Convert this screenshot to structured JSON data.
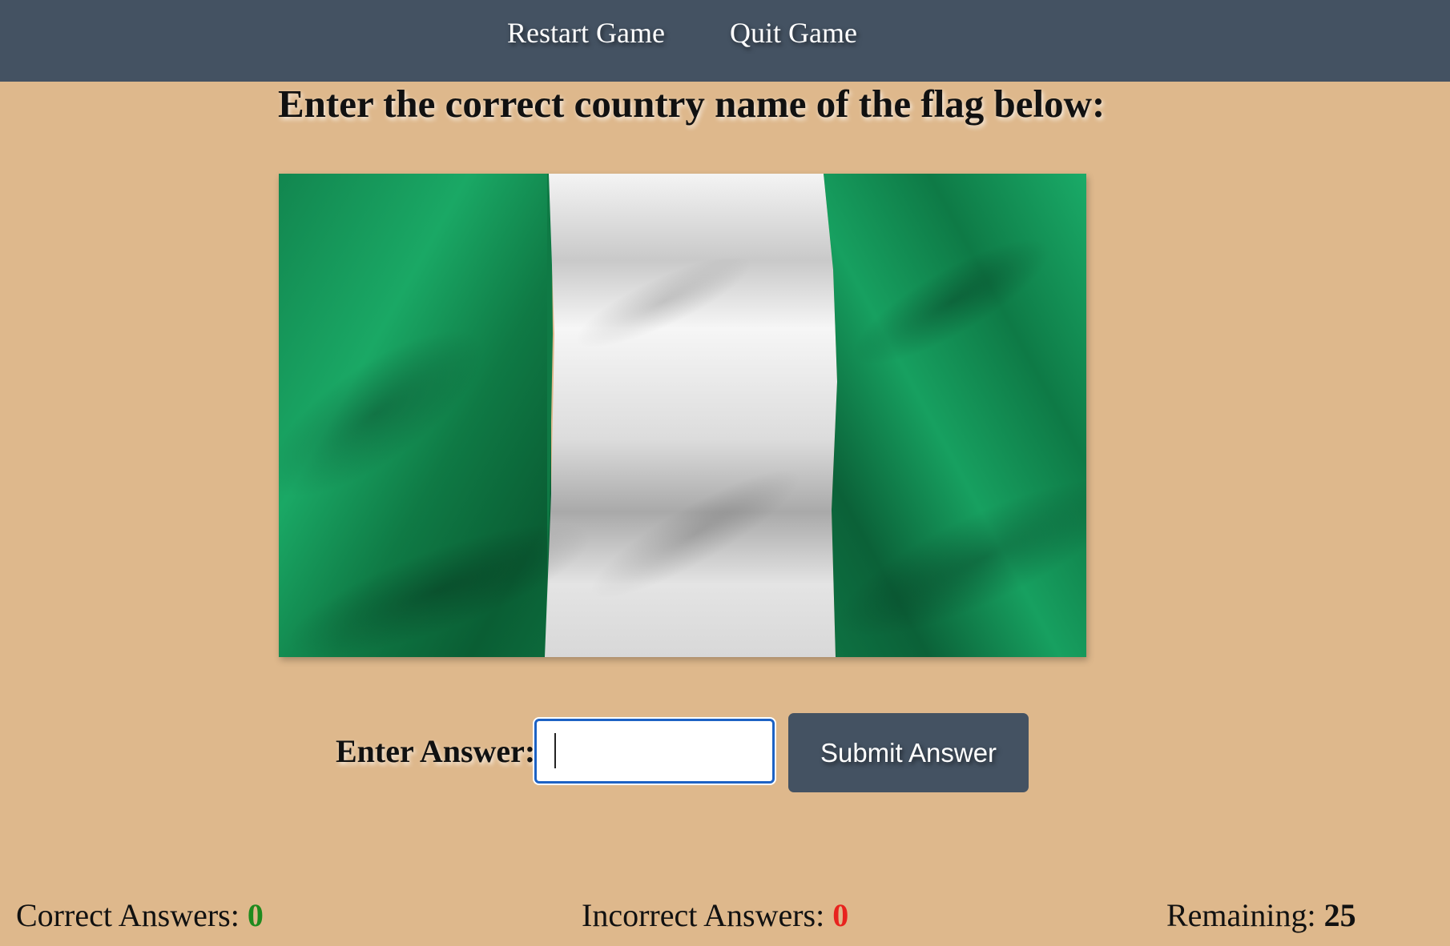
{
  "nav": {
    "restart_label": "Restart Game",
    "quit_label": "Quit Game"
  },
  "prompt": "Enter the correct country name of the flag below:",
  "flag": {
    "icon": "flag-image",
    "colors": {
      "green": "#13915a",
      "white": "#f2f2f2"
    }
  },
  "answer": {
    "label": "Enter Answer:",
    "value": "",
    "submit_label": "Submit Answer"
  },
  "stats": {
    "correct_label": "Correct Answers:",
    "correct_value": "0",
    "correct_color": "#1e8a1e",
    "incorrect_label": "Incorrect Answers:",
    "incorrect_value": "0",
    "incorrect_color": "#e8231e",
    "remaining_label": "Remaining:",
    "remaining_value": "25"
  },
  "theme": {
    "background": "#deb88c",
    "bar": "#445262",
    "input_focus": "#1d62c4"
  }
}
